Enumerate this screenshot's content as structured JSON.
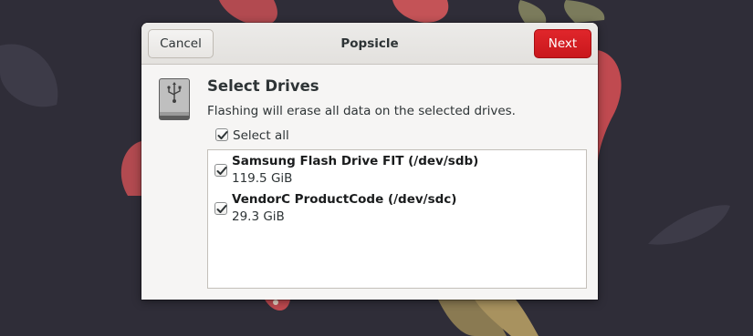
{
  "window": {
    "title": "Popsicle",
    "cancel_label": "Cancel",
    "next_label": "Next"
  },
  "page": {
    "heading": "Select Drives",
    "description": "Flashing will erase all data on the selected drives.",
    "icon": "usb-drive-icon"
  },
  "select_all": {
    "label": "Select all",
    "checked": true
  },
  "drives": [
    {
      "name": "Samsung Flash Drive FIT (/dev/sdb)",
      "size": "119.5 GiB",
      "checked": true
    },
    {
      "name": "VendorC ProductCode (/dev/sdc)",
      "size": "29.3 GiB",
      "checked": true
    }
  ],
  "colors": {
    "accent": "#d4191f",
    "wallpaper": "#2f2d38",
    "dialog_bg": "#f6f5f4"
  }
}
